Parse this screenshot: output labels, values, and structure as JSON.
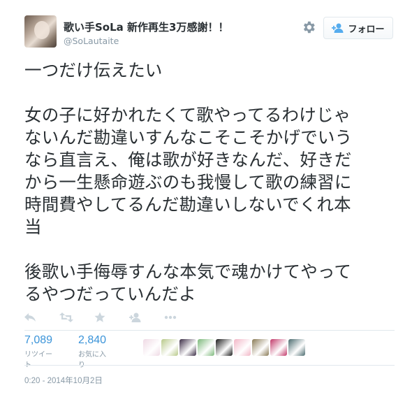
{
  "user": {
    "display_name": "歌い手SoLa 新作再生3万感謝！！",
    "screen_name": "@SoLautaite"
  },
  "follow_button": {
    "label": "フォロー",
    "icon": "add-user-icon"
  },
  "settings_icon": "gear-icon",
  "tweet": {
    "paragraphs": [
      [
        "一つだけ伝えたい"
      ],
      [
        "女の子に好かれたくて歌やってるわけじゃ",
        "ないんだ勘違いすんなこそこそかげでいう",
        "なら直言え、俺は歌が好きなんだ、好きだ",
        "から一生懸命遊ぶのも我慢して歌の練習に",
        "時間費やしてるんだ勘違いしないでくれ本",
        "当"
      ],
      [
        "後歌い手侮辱すんな本気で魂かけてやって",
        "るやつだっていんだよ"
      ]
    ]
  },
  "actions": [
    "reply-icon",
    "retweet-icon",
    "favorite-icon",
    "follow-icon",
    "more-icon"
  ],
  "stats": {
    "retweets": {
      "count": "7,089",
      "label": "リツイート"
    },
    "favorites": {
      "count": "2,840",
      "label": "お気に入り"
    }
  },
  "favoriter_avatars": [
    {
      "color": "#efd9e4"
    },
    {
      "color": "#b8c98a"
    },
    {
      "color": "#3b2d45"
    },
    {
      "color": "#7cb87a"
    },
    {
      "color": "#1a1a1a"
    },
    {
      "color": "#f2b6c6"
    },
    {
      "color": "#8a7a55"
    },
    {
      "color": "#c23a6a"
    },
    {
      "color": "#4a6a6e"
    }
  ],
  "timestamp": "0:20 - 2014年10月2日"
}
